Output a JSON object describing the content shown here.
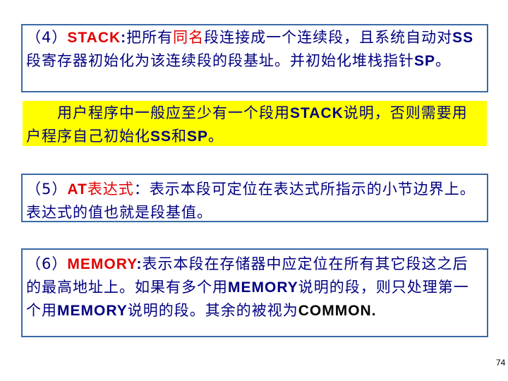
{
  "box1": {
    "prefix": "（4）",
    "term": "STACK",
    "colon": ":",
    "text_a": "把所有",
    "highlight": "同名",
    "text_b": "段连接成一个连续段，且系统自动对",
    "ss": "SS",
    "text_c": "段寄存器初始化为该连续段的段基址。并初始化堆栈指针",
    "sp": "SP",
    "end": "。"
  },
  "box2": {
    "indent": "　　",
    "text_a": "用户程序中一般应至少有一个段用",
    "stack": "STACK",
    "text_b": "说明，否则需要用户程序自己初始化",
    "ss": "SS",
    "and": "和",
    "sp": "SP",
    "end": "。"
  },
  "box3": {
    "prefix": "（5）",
    "term": "AT",
    "term_cn": "表达式",
    "colon": "：",
    "text": "表示本段可定位在表达式所指示的小节边界上。表达式的值也就是段基值。"
  },
  "box4": {
    "prefix": "（6）",
    "term": "MEMORY",
    "colon": ":",
    "text_a": "表示本段在存储器中应定位在所有其它段这之后的最高地址上。如果有多个用",
    "memory1": "MEMORY",
    "text_b": "说明的段，则只处理第一个用",
    "memory2": "MEMORY",
    "text_c": "说明的段。其余的被视为",
    "common": "COMMON."
  },
  "page_number": "74",
  "colors": {
    "text": "#000080",
    "accent": "#e00000",
    "highlight_bg": "#ffff00",
    "border": "#3b6aa6"
  }
}
